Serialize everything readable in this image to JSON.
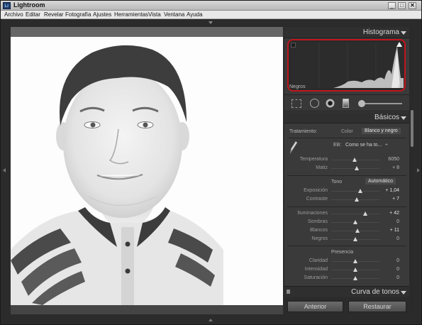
{
  "window": {
    "app_icon": "Lr",
    "title": "Lightroom",
    "controls": [
      "_",
      "□",
      "✕"
    ]
  },
  "menu": [
    "Archivo",
    "Editar",
    "Revelar",
    "Fotografía",
    "Ajustes",
    "Herramientas",
    "Vista",
    "Ventana",
    "Ayuda"
  ],
  "histogram": {
    "title": "Histograma",
    "left_label": "Negros",
    "right_label": "0"
  },
  "basicos": {
    "title": "Básicos",
    "tratamiento_label": "Tratamiento:",
    "tratamiento_options": [
      "Color",
      "Blanco y negro"
    ],
    "eb_label": "EB:",
    "eb_value": "Como se ha to...",
    "eb_suffix": "÷",
    "temperatura": {
      "label": "Temperatura",
      "value": "6050",
      "level": 0.48
    },
    "matiz": {
      "label": "Matiz",
      "value": "+ 8",
      "level": 0.53
    },
    "tono_label": "Tono",
    "automatico_label": "Automático",
    "exposicion": {
      "label": "Exposición",
      "value": "+ 1,04",
      "level": 0.6
    },
    "contraste": {
      "label": "Contraste",
      "value": "+ 7",
      "level": 0.53
    },
    "iluminaciones": {
      "label": "Iluminaciones",
      "value": "+ 42",
      "level": 0.7
    },
    "sombras": {
      "label": "Sombras",
      "value": "0",
      "level": 0.5
    },
    "blancos": {
      "label": "Blancos",
      "value": "+ 11",
      "level": 0.55
    },
    "negros": {
      "label": "Negros",
      "value": "0",
      "level": 0.5
    },
    "presencia_label": "Presencia",
    "claridad": {
      "label": "Claridad",
      "value": "0",
      "level": 0.5
    },
    "intensidad": {
      "label": "Intensidad",
      "value": "0",
      "level": 0.5
    },
    "saturacion": {
      "label": "Saturación",
      "value": "0",
      "level": 0.5
    }
  },
  "curva": {
    "title": "Curva de tonos"
  },
  "buttons": {
    "anterior": "Anterior",
    "restaurar": "Restaurar"
  }
}
